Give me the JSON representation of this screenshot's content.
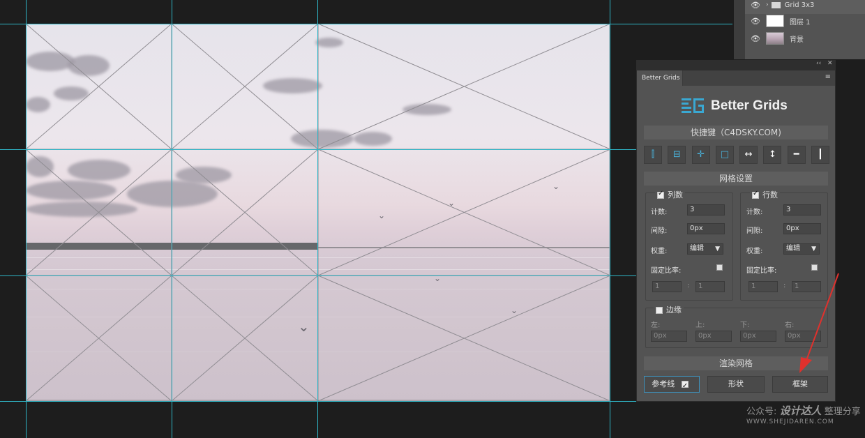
{
  "layers": [
    {
      "name": "Grid 3x3",
      "type": "folder"
    },
    {
      "name": "图层 1",
      "type": "layer"
    },
    {
      "name": "背景",
      "type": "background"
    }
  ],
  "panel": {
    "tab_label": "Better Grids",
    "title": "Better Grids",
    "shortcut_bar": "快捷键（C4DSKY.COM)",
    "grid_settings_bar": "网格设置",
    "columns": {
      "header": "列数",
      "checked": true,
      "count_label": "计数:",
      "count_value": "3",
      "gap_label": "间隙:",
      "gap_value": "0px",
      "weight_label": "权重:",
      "weight_value": "编辑",
      "ratio_label": "固定比率:",
      "ratio_a": "1",
      "ratio_b": "1",
      "ratio_sep": ":"
    },
    "rows": {
      "header": "行数",
      "checked": true,
      "count_label": "计数:",
      "count_value": "3",
      "gap_label": "间隙:",
      "gap_value": "0px",
      "weight_label": "权重:",
      "weight_value": "编辑",
      "ratio_label": "固定比率:",
      "ratio_a": "1",
      "ratio_b": "1",
      "ratio_sep": ":"
    },
    "margin": {
      "header": "边缘",
      "checked": false,
      "left_label": "左:",
      "top_label": "上:",
      "bottom_label": "下:",
      "right_label": "右:",
      "left_value": "0px",
      "top_value": "0px",
      "bottom_value": "0px",
      "right_value": "0px"
    },
    "render_bar": "渲染网格",
    "guides_button": "参考线",
    "guides_checked": true,
    "shape_button": "形状",
    "frame_button": "框架"
  },
  "tools": [
    {
      "icon": "column-split-icon",
      "glyph": "⫿",
      "color": "#49b3dc"
    },
    {
      "icon": "row-split-icon",
      "glyph": "⊟",
      "color": "#49b3dc"
    },
    {
      "icon": "cross-split-icon",
      "glyph": "✛",
      "color": "#49b3dc"
    },
    {
      "icon": "frame-icon",
      "glyph": "□",
      "color": "#49b3dc"
    },
    {
      "icon": "horizontal-arrows-icon",
      "glyph": "↔",
      "color": "#ffffff"
    },
    {
      "icon": "vertical-arrows-icon",
      "glyph": "↕",
      "color": "#ffffff"
    },
    {
      "icon": "horizontal-line-icon",
      "glyph": "━",
      "color": "#ffffff"
    },
    {
      "icon": "vertical-line-icon",
      "glyph": "┃",
      "color": "#ffffff"
    }
  ],
  "watermark": {
    "line1_prefix": "公众号:",
    "line1_brand": "设计达人",
    "line1_suffix": "整理分享",
    "line2": "WWW.SHEJIDAREN.COM"
  },
  "colors": {
    "guide": "#2fb6c7",
    "accent": "#49b3dc",
    "arrow": "#e0312d"
  }
}
